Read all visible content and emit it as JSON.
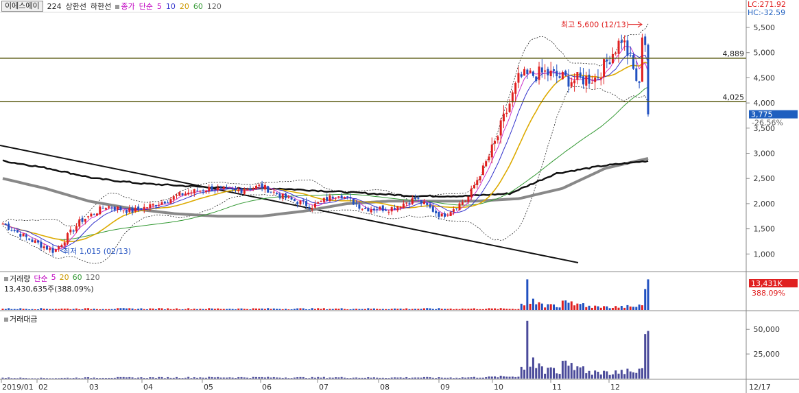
{
  "header": {
    "stock_name": "이에스에이",
    "stock_code": "224",
    "upper_limit": "상한선",
    "lower_limit": "하한선",
    "close_label": "종가",
    "ma_type": "단순",
    "periods": [
      "5",
      "10",
      "20",
      "60",
      "120"
    ]
  },
  "lc_hc": {
    "lc": "LC:271.92",
    "hc": "HC:-32.59"
  },
  "volume_panel": {
    "title": "거래량",
    "ma_type": "단순",
    "periods": [
      "5",
      "20",
      "60",
      "120"
    ],
    "value_text": "13,430,635주(388.09%)",
    "badge": "13,431K",
    "badge_pct": "388.09%",
    "ma_colors": [
      "#cc33cc",
      "#ddaa00",
      "#339933",
      "#888888"
    ]
  },
  "amount_panel": {
    "title": "거래대금",
    "ticks": [
      "50,000",
      "25,000"
    ]
  },
  "annotations": {
    "high": "최고 5,600 (12/13)",
    "low": "최저 1,015 (02/13)",
    "hline_high": "4,889",
    "hline_low": "4,025",
    "price_badge": "3,775",
    "price_pct": "-26.56%"
  },
  "colors": {
    "up": "#e02020",
    "down": "#2050c0",
    "ma5": "#cc33cc",
    "ma10": "#3333cc",
    "ma20": "#ddaa00",
    "ma60": "#339933",
    "ma120": "#888888",
    "hline": "#5a5a10",
    "badge_blue": "#1f5fbf",
    "badge_red": "#e02020"
  },
  "chart_data": {
    "type": "candlestick",
    "y_ticks": [
      "5,500",
      "5,000",
      "4,500",
      "4,000",
      "3,500",
      "3,000",
      "2,500",
      "2,000",
      "1,500",
      "1,000"
    ],
    "ylim": [
      650,
      5800
    ],
    "x_ticks": [
      "2019/01",
      "02",
      "03",
      "04",
      "05",
      "06",
      "07",
      "08",
      "09",
      "10",
      "11",
      "12",
      "12/17"
    ],
    "close_anchor": [
      {
        "d": "2019/01",
        "v": 1600
      },
      {
        "d": "02",
        "v": 1300
      },
      {
        "d": "02/13",
        "v": 1050
      },
      {
        "d": "03",
        "v": 1650
      },
      {
        "d": "03b",
        "v": 1950
      },
      {
        "d": "04",
        "v": 1850
      },
      {
        "d": "04b",
        "v": 2000
      },
      {
        "d": "05",
        "v": 2200
      },
      {
        "d": "05b",
        "v": 2300
      },
      {
        "d": "06",
        "v": 2250
      },
      {
        "d": "06b",
        "v": 2350
      },
      {
        "d": "07",
        "v": 2100
      },
      {
        "d": "07b",
        "v": 1950
      },
      {
        "d": "08",
        "v": 2200
      },
      {
        "d": "08b",
        "v": 1900
      },
      {
        "d": "09",
        "v": 1900
      },
      {
        "d": "09b",
        "v": 2100
      },
      {
        "d": "10",
        "v": 1750
      },
      {
        "d": "10b",
        "v": 2100
      },
      {
        "d": "10c",
        "v": 3100
      },
      {
        "d": "11",
        "v": 4500
      },
      {
        "d": "11b",
        "v": 4600
      },
      {
        "d": "11c",
        "v": 4450
      },
      {
        "d": "12",
        "v": 4500
      },
      {
        "d": "12/13",
        "v": 5300
      },
      {
        "d": "12/17",
        "v": 3775
      }
    ],
    "ma120_anchor": [
      2500,
      2300,
      2050,
      1900,
      1800,
      1750,
      1750,
      1850,
      2000,
      2050,
      2050,
      2050,
      2100,
      2300,
      2700,
      2900
    ],
    "ma60_anchor": [
      2850,
      2700,
      2500,
      2400,
      2350,
      2300,
      2300,
      2250,
      2200,
      2150,
      2150,
      2200,
      2600,
      2750,
      2850
    ]
  }
}
